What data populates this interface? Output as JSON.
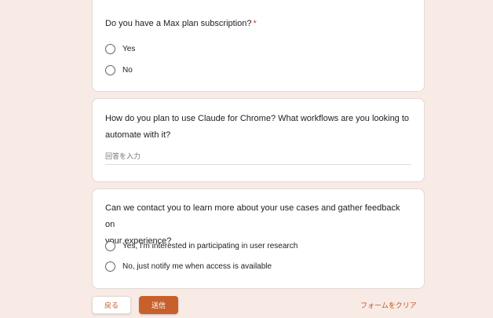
{
  "theme": {
    "background": "#f8ebe6",
    "accent": "#c8602c",
    "required_color": "#d93025"
  },
  "questions": [
    {
      "title": "Do you have a Max plan subscription?",
      "required_mark": "*",
      "type": "radio",
      "options": [
        "Yes",
        "No"
      ]
    },
    {
      "title_line1": "How do you plan to use Claude for Chrome? What workflows are you looking to",
      "title_line2": "automate with it?",
      "type": "text",
      "placeholder": "回答を入力"
    },
    {
      "title_line1": "Can we contact you to learn more about your use cases and gather feedback on",
      "title_line2": "your experience?",
      "type": "radio",
      "options": [
        "Yes, I'm interested in participating in user research",
        "No, just notify me when access is available"
      ]
    }
  ],
  "footer": {
    "back_label": "戻る",
    "submit_label": "送信",
    "clear_label": "フォームをクリア"
  }
}
